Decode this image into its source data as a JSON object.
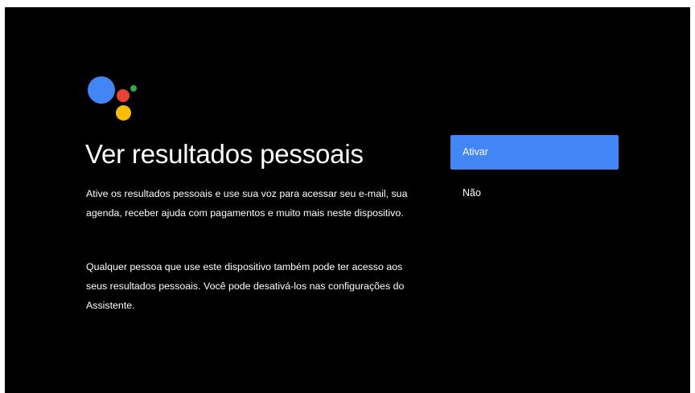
{
  "colors": {
    "background": "#000000",
    "accent": "#4285f4",
    "logo_blue": "#4285f4",
    "logo_red": "#ea4335",
    "logo_yellow": "#fbbc04",
    "logo_green": "#34a853"
  },
  "logo": {
    "icon": "google-assistant-icon"
  },
  "screen": {
    "title": "Ver resultados pessoais",
    "paragraphs": [
      "Ative os resultados pessoais e use sua voz para acessar seu e-mail, sua agenda, receber ajuda com pagamentos e muito mais neste dispositivo.",
      "Qualquer pessoa que use este dispositivo também pode ter acesso aos seus resultados pessoais. Você pode desativá-los nas configurações do Assistente."
    ]
  },
  "options": [
    {
      "label": "Ativar",
      "selected": true
    },
    {
      "label": "Não",
      "selected": false
    }
  ]
}
